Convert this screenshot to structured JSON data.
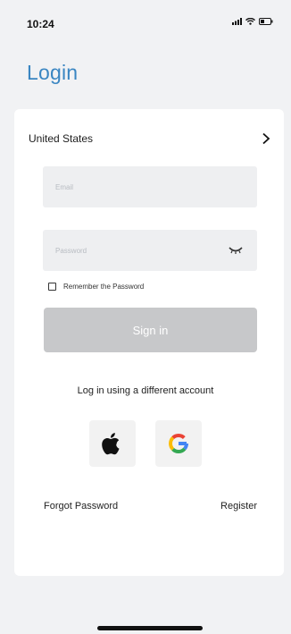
{
  "status_bar": {
    "time": "10:24",
    "icons": [
      "signal-icon",
      "wifi-icon",
      "battery-icon"
    ]
  },
  "header": {
    "title": "Login"
  },
  "form": {
    "country": "United States",
    "email": {
      "value": "",
      "placeholder": "Email"
    },
    "password": {
      "value": "",
      "placeholder": "Password"
    },
    "remember_label": "Remember the Password",
    "remember_checked": false,
    "signin_label": "Sign in"
  },
  "social": {
    "label": "Log in using a different account",
    "providers": [
      "apple-icon",
      "google-icon"
    ]
  },
  "links": {
    "forgot": "Forgot Password",
    "register": "Register"
  },
  "colors": {
    "title": "#3a86c2",
    "background": "#f1f2f4",
    "card": "#ffffff",
    "input": "#eeeff1",
    "button_disabled": "#c7c8ca"
  }
}
